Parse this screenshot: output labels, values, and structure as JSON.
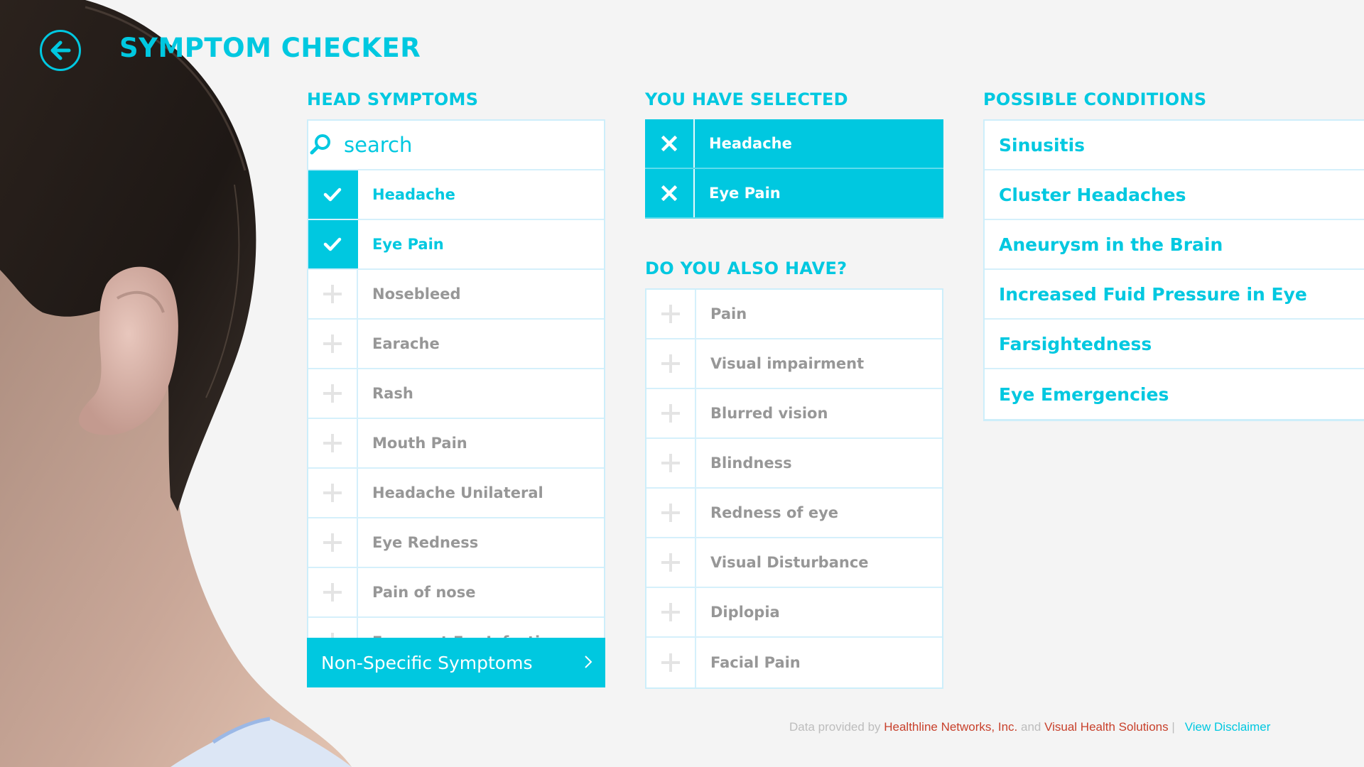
{
  "app": {
    "title": "SYMPTOM CHECKER",
    "back_icon": "arrow-left-circle-icon"
  },
  "colors": {
    "accent": "#00c8e0",
    "background": "#f4f4f4",
    "muted_text": "#979797",
    "footer_link": "#c8412c"
  },
  "head_symptoms": {
    "header": "HEAD SYMPTOMS",
    "search": {
      "placeholder": "search",
      "value": "",
      "icon": "search-icon"
    },
    "items": [
      {
        "label": "Headache",
        "checked": true
      },
      {
        "label": "Eye Pain",
        "checked": true
      },
      {
        "label": "Nosebleed",
        "checked": false
      },
      {
        "label": "Earache",
        "checked": false
      },
      {
        "label": "Rash",
        "checked": false
      },
      {
        "label": "Mouth Pain",
        "checked": false
      },
      {
        "label": "Headache Unilateral",
        "checked": false
      },
      {
        "label": "Eye Redness",
        "checked": false
      },
      {
        "label": "Pain of nose",
        "checked": false
      },
      {
        "label": "Frequent Ear Infections",
        "checked": false
      }
    ],
    "non_specific_button": "Non-Specific Symptoms"
  },
  "selected": {
    "header": "YOU HAVE SELECTED",
    "items": [
      {
        "label": "Headache"
      },
      {
        "label": "Eye Pain"
      }
    ]
  },
  "also_have": {
    "header": "DO YOU ALSO HAVE?",
    "items": [
      {
        "label": "Pain"
      },
      {
        "label": "Visual impairment"
      },
      {
        "label": "Blurred vision"
      },
      {
        "label": "Blindness"
      },
      {
        "label": "Redness of eye"
      },
      {
        "label": "Visual Disturbance"
      },
      {
        "label": "Diplopia"
      },
      {
        "label": "Facial Pain"
      }
    ]
  },
  "conditions": {
    "header": "POSSIBLE CONDITIONS",
    "items": [
      {
        "label": "Sinusitis"
      },
      {
        "label": "Cluster Headaches"
      },
      {
        "label": "Aneurysm in the Brain"
      },
      {
        "label": "Increased Fuid Pressure in Eye"
      },
      {
        "label": "Farsightedness"
      },
      {
        "label": "Eye Emergencies"
      }
    ]
  },
  "footer": {
    "prefix": "Data provided by ",
    "provider1": "Healthline Networks, Inc.",
    "joiner": " and ",
    "provider2": "Visual Health Solutions",
    "separator": " |",
    "disclaimer": "View Disclaimer"
  }
}
